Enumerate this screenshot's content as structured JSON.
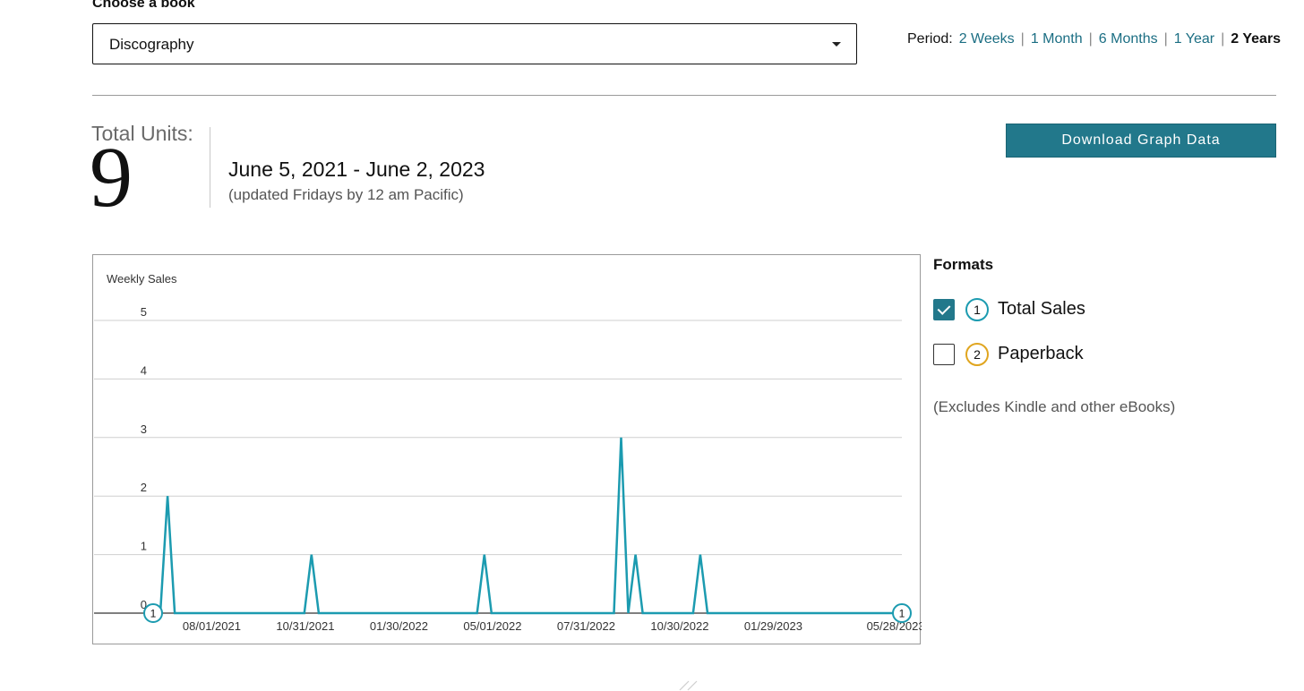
{
  "book_select": {
    "label": "Choose a book",
    "value": "Discography"
  },
  "period": {
    "label": "Period:",
    "options": [
      {
        "label": "2 Weeks",
        "active": false
      },
      {
        "label": "1 Month",
        "active": false
      },
      {
        "label": "6 Months",
        "active": false
      },
      {
        "label": "1 Year",
        "active": false
      },
      {
        "label": "2 Years",
        "active": true
      }
    ]
  },
  "summary": {
    "total_label": "Total Units:",
    "total_value": "9",
    "date_range": "June 5, 2021 - June 2, 2023",
    "update_note": "(updated Fridays by 12 am Pacific)"
  },
  "download_button": "Download Graph Data",
  "formats": {
    "title": "Formats",
    "items": [
      {
        "badge": "1",
        "label": "Total Sales",
        "checked": true,
        "color": "#1c9bb0"
      },
      {
        "badge": "2",
        "label": "Paperback",
        "checked": false,
        "color": "#e0a51f"
      }
    ],
    "note": "(Excludes Kindle and other eBooks)"
  },
  "chart_data": {
    "type": "line",
    "ylabel": "Weekly Sales",
    "ylim": [
      0,
      5
    ],
    "yticks": [
      0,
      1,
      2,
      3,
      4,
      5
    ],
    "x_tick_labels": [
      "08/01/2021",
      "10/31/2021",
      "01/30/2022",
      "05/01/2022",
      "07/31/2022",
      "10/30/2022",
      "01/29/2023",
      "05/28/2023"
    ],
    "grid": true,
    "series": [
      {
        "color": "#1c9bb0",
        "marker_label": "1",
        "x": [
          "2021-06-05",
          "2021-06-12",
          "2021-06-19",
          "2021-06-26",
          "2021-07-03",
          "2021-07-10",
          "2021-07-17",
          "2021-07-24",
          "2021-07-31",
          "2021-08-07",
          "2021-08-14",
          "2021-08-21",
          "2021-08-28",
          "2021-09-04",
          "2021-09-11",
          "2021-09-18",
          "2021-09-25",
          "2021-10-02",
          "2021-10-09",
          "2021-10-16",
          "2021-10-23",
          "2021-10-30",
          "2021-11-06",
          "2021-11-13",
          "2021-11-20",
          "2021-11-27",
          "2021-12-04",
          "2021-12-11",
          "2021-12-18",
          "2021-12-25",
          "2022-01-01",
          "2022-01-08",
          "2022-01-15",
          "2022-01-22",
          "2022-01-29",
          "2022-02-05",
          "2022-02-12",
          "2022-02-19",
          "2022-02-26",
          "2022-03-05",
          "2022-03-12",
          "2022-03-19",
          "2022-03-26",
          "2022-04-02",
          "2022-04-09",
          "2022-04-16",
          "2022-04-23",
          "2022-04-30",
          "2022-05-07",
          "2022-05-14",
          "2022-05-21",
          "2022-05-28",
          "2022-06-04",
          "2022-06-11",
          "2022-06-18",
          "2022-06-25",
          "2022-07-02",
          "2022-07-09",
          "2022-07-16",
          "2022-07-23",
          "2022-07-30",
          "2022-08-06",
          "2022-08-13",
          "2022-08-20",
          "2022-08-27",
          "2022-09-03",
          "2022-09-10",
          "2022-09-17",
          "2022-09-24",
          "2022-10-01",
          "2022-10-08",
          "2022-10-15",
          "2022-10-22",
          "2022-10-29",
          "2022-11-05",
          "2022-11-12",
          "2022-11-19",
          "2022-11-26",
          "2022-12-03",
          "2022-12-10",
          "2022-12-17",
          "2022-12-24",
          "2022-12-31",
          "2023-01-07",
          "2023-01-14",
          "2023-01-21",
          "2023-01-28",
          "2023-02-04",
          "2023-02-11",
          "2023-02-18",
          "2023-02-25",
          "2023-03-04",
          "2023-03-11",
          "2023-03-18",
          "2023-03-25",
          "2023-04-01",
          "2023-04-08",
          "2023-04-15",
          "2023-04-22",
          "2023-04-29",
          "2023-05-06",
          "2023-05-13",
          "2023-05-20",
          "2023-05-27",
          "2023-06-03"
        ],
        "values": [
          0,
          0,
          2,
          0,
          0,
          0,
          0,
          0,
          0,
          0,
          0,
          0,
          0,
          0,
          0,
          0,
          0,
          0,
          0,
          0,
          0,
          0,
          1,
          0,
          0,
          0,
          0,
          0,
          0,
          0,
          0,
          0,
          0,
          0,
          0,
          0,
          0,
          0,
          0,
          0,
          0,
          0,
          0,
          0,
          0,
          0,
          1,
          0,
          0,
          0,
          0,
          0,
          0,
          0,
          0,
          0,
          0,
          0,
          0,
          0,
          0,
          0,
          0,
          0,
          0,
          3,
          0,
          1,
          0,
          0,
          0,
          0,
          0,
          0,
          0,
          0,
          1,
          0,
          0,
          0,
          0,
          0,
          0,
          0,
          0,
          0,
          0,
          0,
          0,
          0,
          0,
          0,
          0,
          0,
          0,
          0,
          0,
          0,
          0,
          0,
          0,
          0,
          0,
          0,
          0
        ]
      }
    ]
  }
}
